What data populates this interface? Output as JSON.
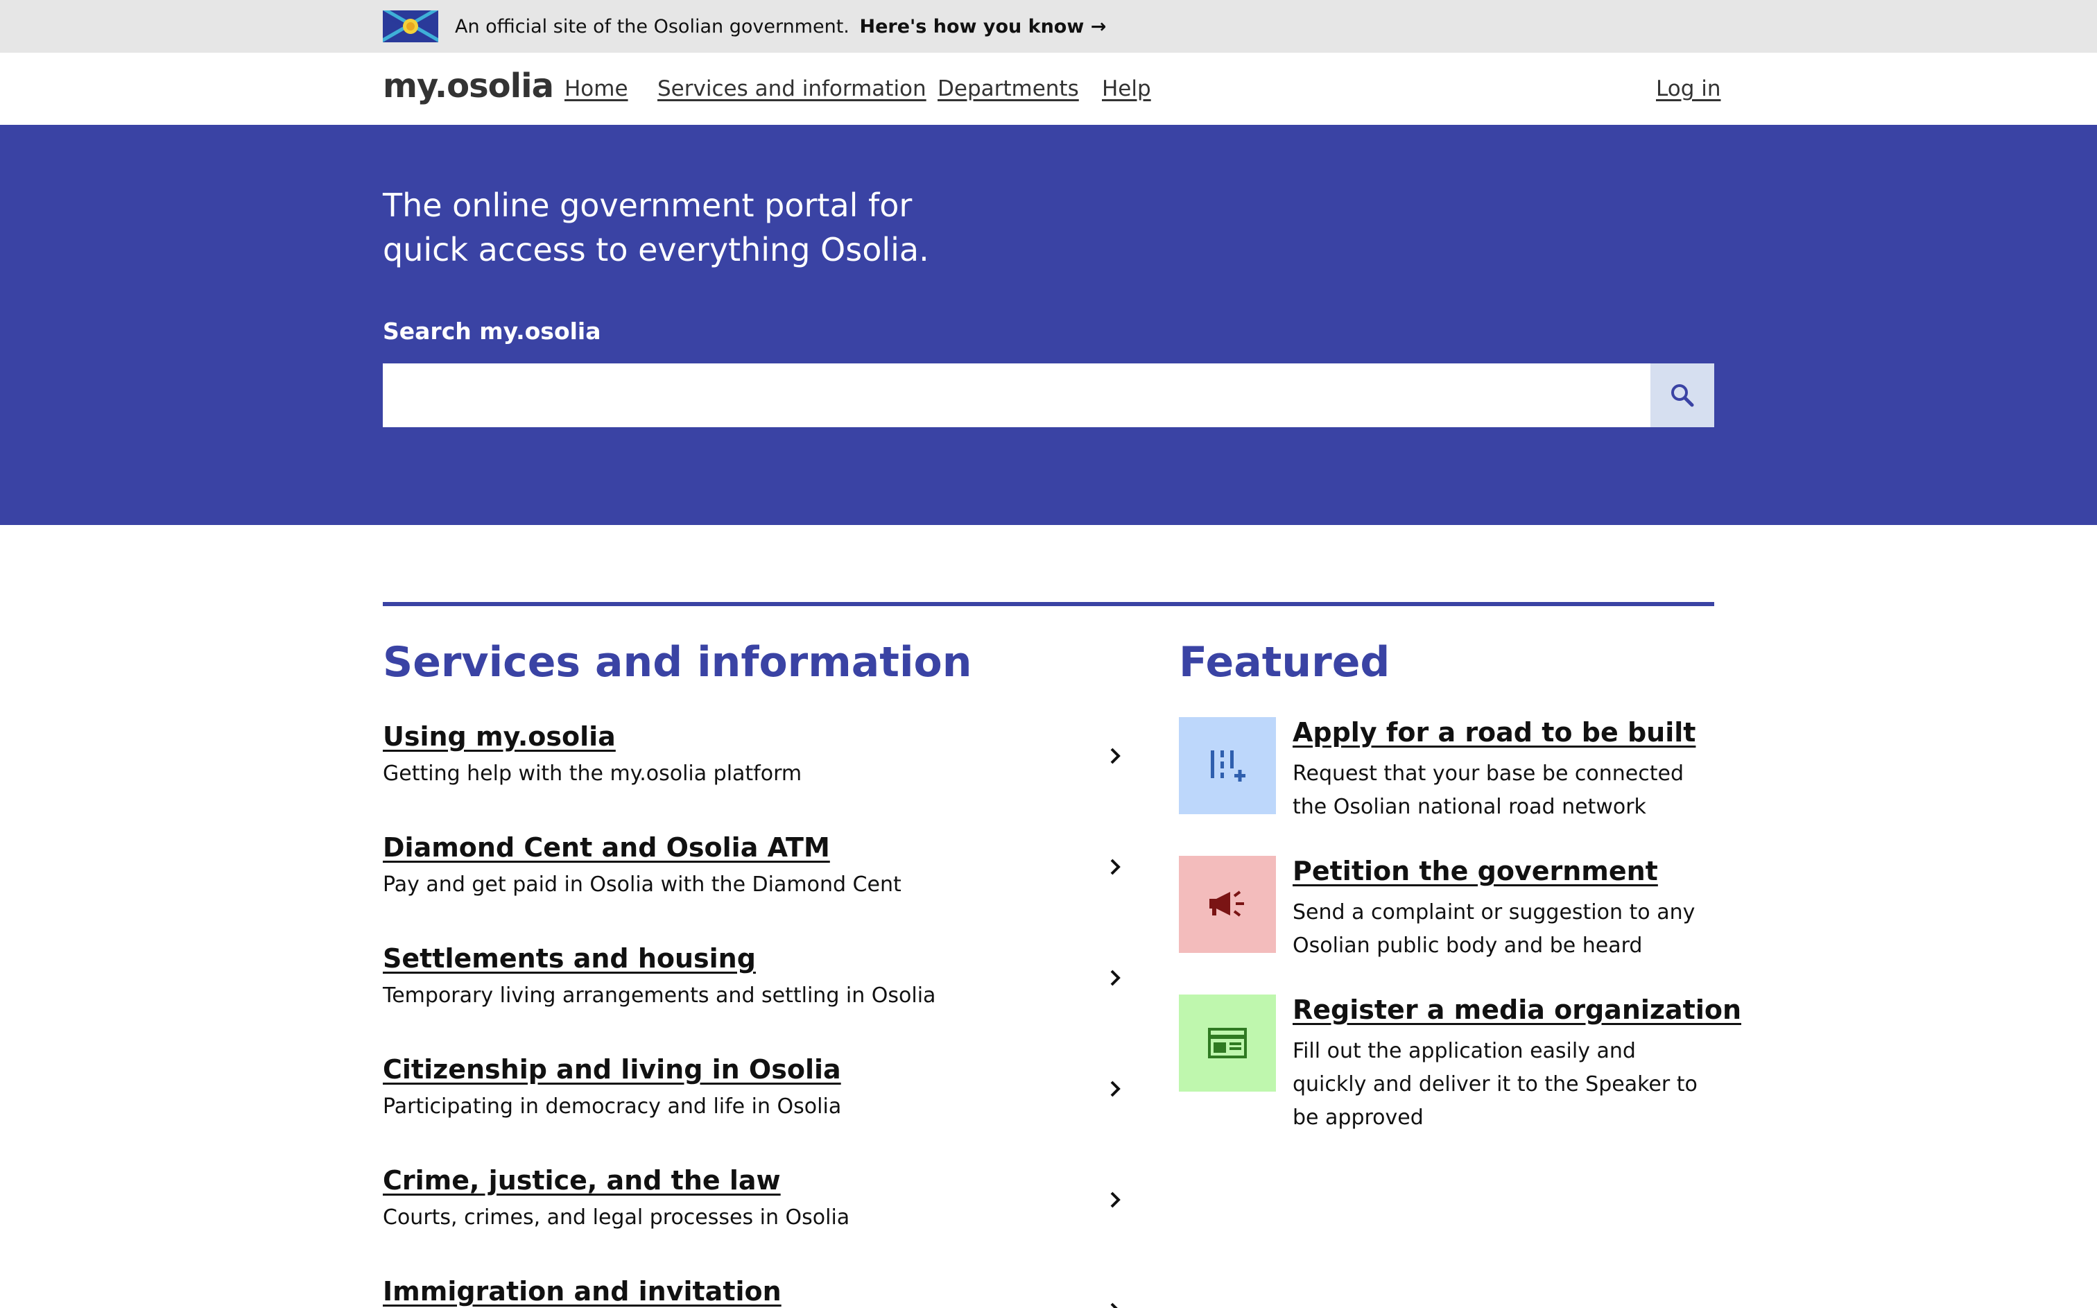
{
  "banner": {
    "text": "An official site of the Osolian government.",
    "link": "Here's how you know →"
  },
  "header": {
    "logo": "my.osolia",
    "nav": [
      "Home",
      "Services and information",
      "Departments",
      "Help"
    ],
    "login": "Log in"
  },
  "hero": {
    "title": "The online government portal for quick access to everything Osolia.",
    "search_label": "Search my.osolia",
    "search_value": ""
  },
  "services": {
    "title": "Services and information",
    "items": [
      {
        "title": "Using my.osolia",
        "desc": "Getting help with the my.osolia platform"
      },
      {
        "title": "Diamond Cent and Osolia ATM",
        "desc": "Pay and get paid in Osolia with the Diamond Cent"
      },
      {
        "title": "Settlements and housing",
        "desc": "Temporary living arrangements and settling in Osolia"
      },
      {
        "title": "Citizenship and living in Osolia",
        "desc": "Participating in democracy and life in Osolia"
      },
      {
        "title": "Crime, justice, and the law",
        "desc": "Courts, crimes, and legal processes in Osolia"
      },
      {
        "title": "Immigration and invitation",
        "desc": ""
      }
    ]
  },
  "featured": {
    "title": "Featured",
    "items": [
      {
        "title": "Apply for a road to be built",
        "desc": "Request that your base be connected the Osolian national road network",
        "icon": "road-icon",
        "bg": "#bdd7fb",
        "fg": "#2f5fae"
      },
      {
        "title": "Petition the government",
        "desc": "Send a complaint or suggestion to any Osolian public body and be heard",
        "icon": "megaphone-icon",
        "bg": "#f3bcbc",
        "fg": "#7a1414"
      },
      {
        "title": "Register a media organization",
        "desc": "Fill out the application easily and quickly and deliver it to the Speaker to be approved",
        "icon": "newspaper-icon",
        "bg": "#bff7ae",
        "fg": "#2f7a22"
      }
    ]
  },
  "colors": {
    "brand": "#3a43a4",
    "banner_bg": "#e6e6e6",
    "search_button_bg": "#d6dff0"
  }
}
